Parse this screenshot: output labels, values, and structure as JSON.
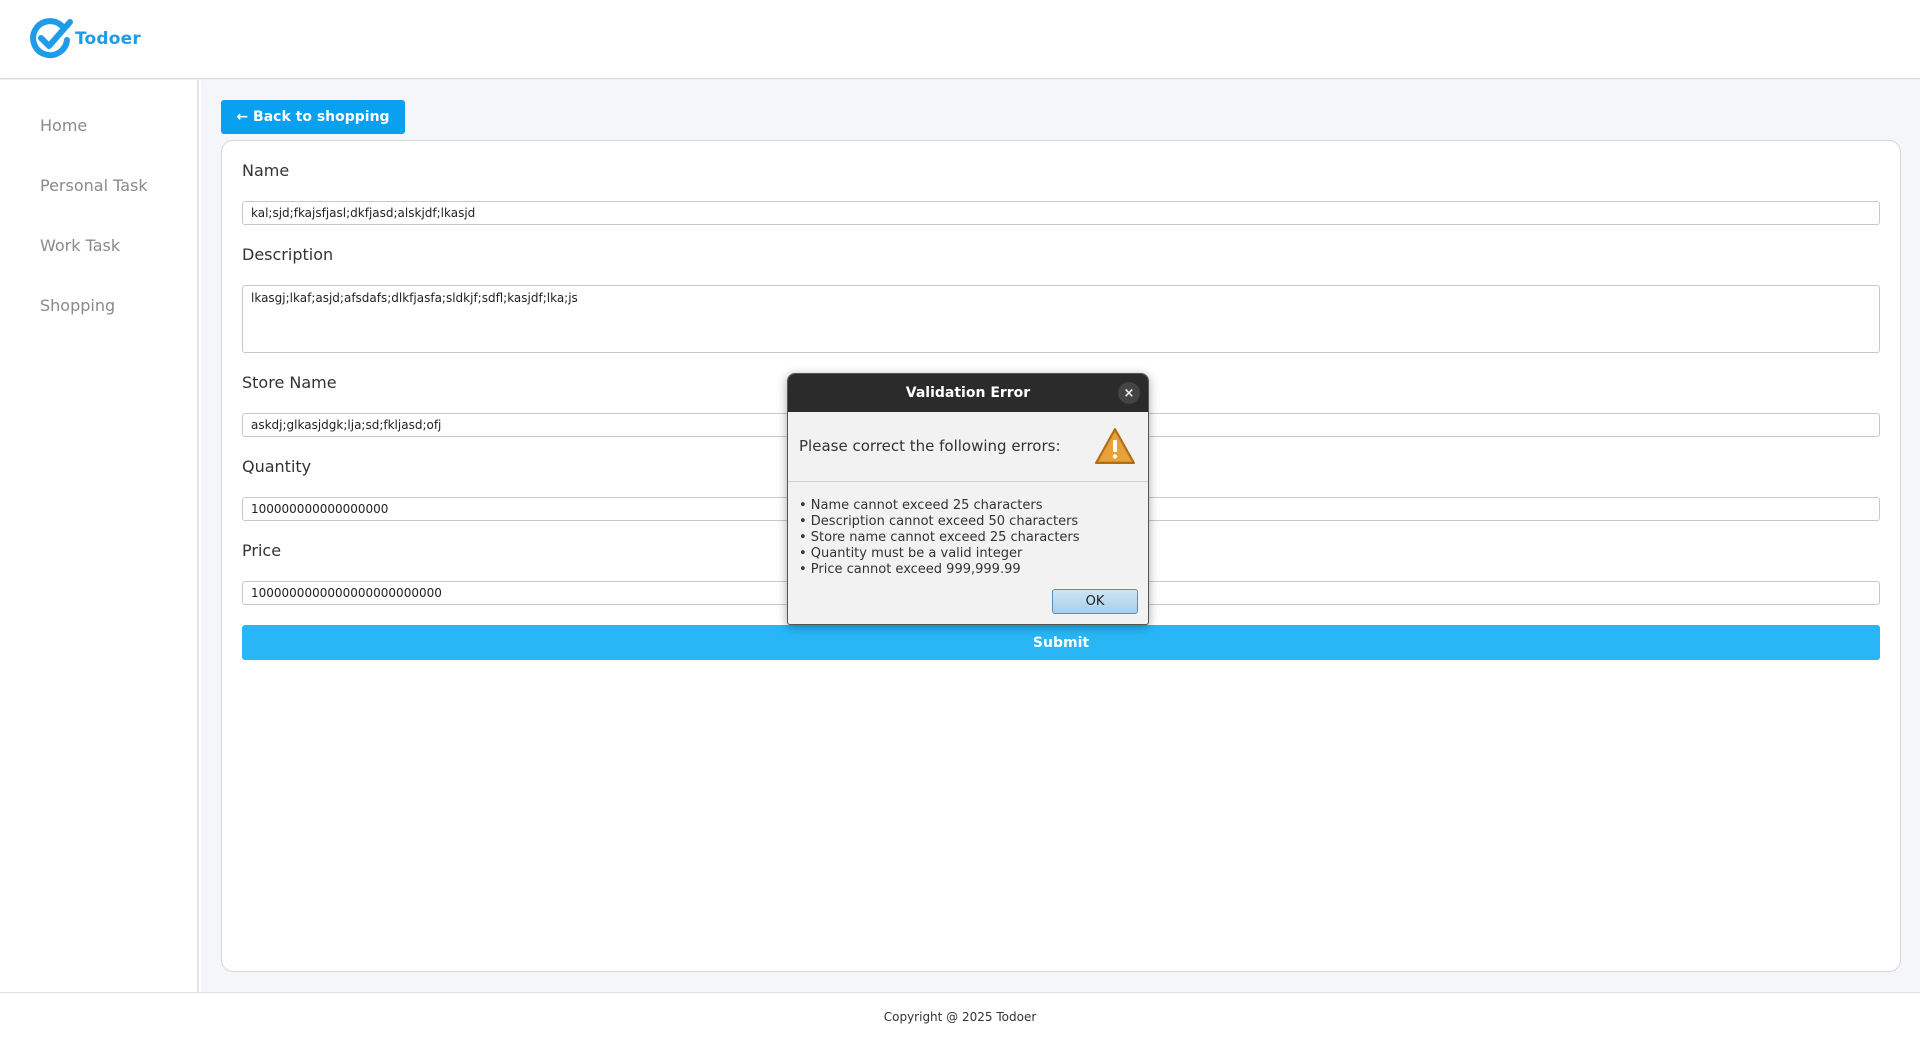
{
  "app": {
    "logo_text": "Todoer",
    "brand_color": "#1E9BE9"
  },
  "sidebar": {
    "items": [
      {
        "label": "Home"
      },
      {
        "label": "Personal Task"
      },
      {
        "label": "Work Task"
      },
      {
        "label": "Shopping"
      }
    ]
  },
  "main": {
    "back_button_label": "← Back to shopping",
    "form": {
      "name_label": "Name",
      "name_value": "kal;sjd;fkajsfjasl;dkfjasd;alskjdf;lkasjd",
      "description_label": "Description",
      "description_value": "lkasgj;lkaf;asjd;afsdafs;dlkfjasfa;sldkjf;sdfl;kasjdf;lka;js",
      "store_label": "Store Name",
      "store_value": "askdj;glkasjdgk;lja;sd;fkljasd;ofj",
      "quantity_label": "Quantity",
      "quantity_value": "100000000000000000",
      "price_label": "Price",
      "price_value": "1000000000000000000000000",
      "submit_label": "Submit"
    }
  },
  "dialog": {
    "title": "Validation Error",
    "close_glyph": "×",
    "header_text": "Please correct the following errors:",
    "icon": "warning-icon",
    "errors": [
      "• Name cannot exceed 25 characters",
      "• Description cannot exceed 50 characters",
      "• Store name cannot exceed 25 characters",
      "• Quantity must be a valid integer",
      "• Price cannot exceed 999,999.99"
    ],
    "ok_label": "OK"
  },
  "footer": {
    "copyright": "Copyright @ 2025 Todoer"
  }
}
